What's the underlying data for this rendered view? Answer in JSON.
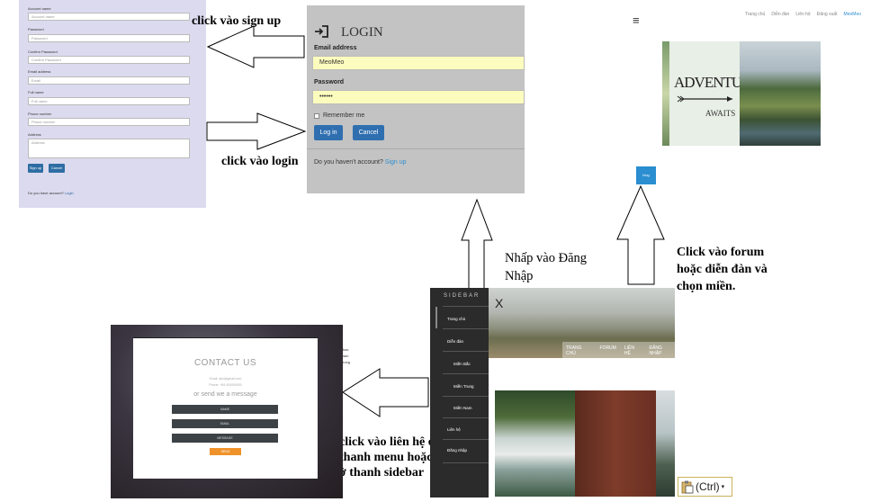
{
  "signup": {
    "fields": [
      {
        "label": "Account name",
        "placeholder": "Account name"
      },
      {
        "label": "Password",
        "placeholder": "Password"
      },
      {
        "label": "Confirm Password",
        "placeholder": "Confirm Password"
      },
      {
        "label": "Email address",
        "placeholder": "Email"
      },
      {
        "label": "Full name",
        "placeholder": "Full name"
      },
      {
        "label": "Phone number",
        "placeholder": "Phone number"
      },
      {
        "label": "Address",
        "placeholder": "Address"
      }
    ],
    "signup_button": "Sign up",
    "cancel_button": "Cancel",
    "have_account_text": "Do you have account?",
    "login_link": "Login"
  },
  "login": {
    "title": "LOGIN",
    "email_label": "Email address",
    "email_value": "MeoMeo",
    "password_label": "Password",
    "password_value": "••••••",
    "remember_label": "Remember me",
    "login_button": "Log in",
    "cancel_button": "Cancel",
    "no_account_text": "Do you haven't account?",
    "signup_link": "Sign up"
  },
  "annotations": {
    "sign_up": "click vào sign up",
    "login": "click vào login",
    "register": "Nhấp vào Đăng Nhập",
    "forum": "Click vào forum hoặc diễn đàn và chọn miền.",
    "contact": "click vào liên hệ ở thanh menu hoặc ở thanh sidebar"
  },
  "topnav": {
    "menu_icon": "≡",
    "links": [
      "Trang chủ",
      "Diễn đàn",
      "Liên hệ",
      "Đăng xuất"
    ],
    "user": "MeoMeo"
  },
  "banner": {
    "word1": "ADVENTURE",
    "word2": "AWAITS"
  },
  "blog_button": "blog",
  "sidebar": {
    "title": "SIDEBAR",
    "items": [
      "Trang chủ",
      "Diễn đàn",
      "Miền Bắc",
      "Miền Trung",
      "Miền Nam",
      "Liên hệ",
      "Đăng nhập"
    ]
  },
  "hero": {
    "close": "X",
    "menu": [
      "TRANG CHỦ",
      "FORUM",
      "LIÊN HỆ",
      "ĐĂNG NHẬP"
    ]
  },
  "contact": {
    "title": "CONTACT US",
    "email": "Email: abc@gmail.com",
    "phone": "Phone: +84 000000000",
    "subtitle": "or send we a message",
    "fields": [
      "NAME",
      "EMAIL",
      "MESSAGE"
    ],
    "send": "SEND",
    "side_text": [
      "bac",
      "iam",
      "rung"
    ]
  },
  "paste_options": "(Ctrl)"
}
